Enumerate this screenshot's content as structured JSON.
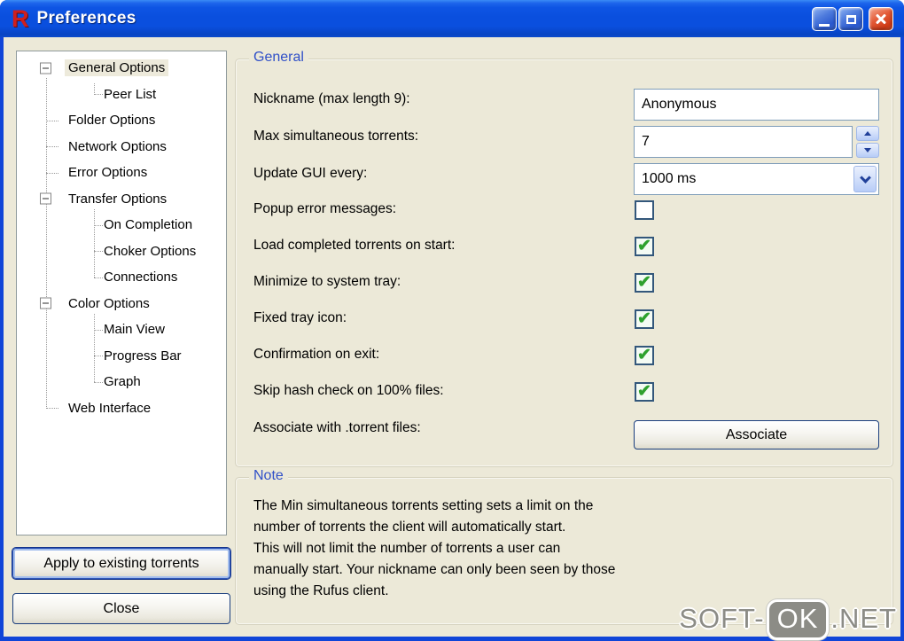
{
  "window": {
    "title": "Preferences",
    "icon_letter": "R"
  },
  "tree": {
    "items": [
      {
        "label": "General Options",
        "level": 0,
        "expander": "minus",
        "selected": true
      },
      {
        "label": "Peer List",
        "level": 1
      },
      {
        "label": "Folder Options",
        "level": 0
      },
      {
        "label": "Network Options",
        "level": 0
      },
      {
        "label": "Error Options",
        "level": 0
      },
      {
        "label": "Transfer Options",
        "level": 0,
        "expander": "minus"
      },
      {
        "label": "On Completion",
        "level": 1
      },
      {
        "label": "Choker Options",
        "level": 1
      },
      {
        "label": "Connections",
        "level": 1
      },
      {
        "label": "Color Options",
        "level": 0,
        "expander": "minus"
      },
      {
        "label": "Main View",
        "level": 1
      },
      {
        "label": "Progress Bar",
        "level": 1
      },
      {
        "label": "Graph",
        "level": 1
      },
      {
        "label": "Web Interface",
        "level": 0
      }
    ]
  },
  "sidebar": {
    "apply_button": "Apply to existing torrents",
    "close_button": "Close"
  },
  "general": {
    "legend": "General",
    "nickname_label": "Nickname (max length 9):",
    "nickname_value": "Anonymous",
    "max_torrents_label": "Max simultaneous torrents:",
    "max_torrents_value": "7",
    "update_gui_label": "Update GUI every:",
    "update_gui_value": "1000 ms",
    "checkboxes": [
      {
        "label": "Popup error messages:",
        "checked": false
      },
      {
        "label": "Load completed torrents on start:",
        "checked": true
      },
      {
        "label": "Minimize to system tray:",
        "checked": true
      },
      {
        "label": "Fixed tray icon:",
        "checked": true
      },
      {
        "label": "Confirmation on exit:",
        "checked": true
      },
      {
        "label": "Skip hash check on 100% files:",
        "checked": true
      }
    ],
    "associate_label": "Associate with .torrent files:",
    "associate_button": "Associate"
  },
  "note": {
    "legend": "Note",
    "lines": [
      "The Min simultaneous torrents setting sets a limit on the",
      "number of torrents the client will automatically start.",
      "This  will not limit the number of torrents a user can",
      "manually start. Your nickname can only been seen by those",
      "using the Rufus client."
    ]
  },
  "watermark": {
    "prefix": "SOFT-",
    "badge": "OK",
    "suffix": ".NET"
  },
  "colors": {
    "titlebar_blue": "#0A4FDE",
    "dialog_bg": "#ECE9D8",
    "groupbox_label_blue": "#3050C8",
    "check_green": "#2EA12E",
    "close_button_red": "#D64424",
    "app_icon_red": "#CE1F1F",
    "watermark_gray": "#8C8C86"
  }
}
